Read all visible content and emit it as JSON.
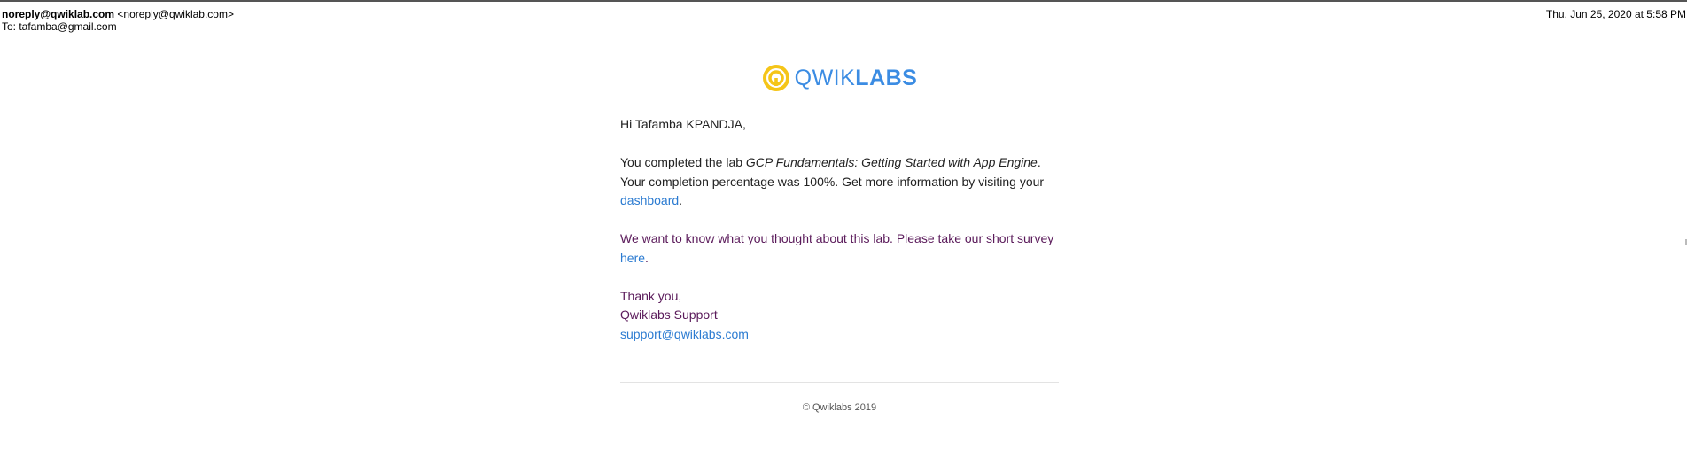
{
  "header": {
    "from_name": "noreply@qwiklab.com",
    "from_address": "<noreply@qwiklab.com>",
    "to_line": "To: tafamba@gmail.com",
    "date": "Thu, Jun 25, 2020 at 5:58 PM"
  },
  "logo": {
    "text_light": "QWIK",
    "text_bold": "LABS",
    "colors": {
      "ring": "#f5c518",
      "text": "#3b8ce3"
    }
  },
  "email": {
    "greeting": "Hi Tafamba KPANDJA,",
    "completed_prefix": "You completed the lab ",
    "lab_name": "GCP Fundamentals: Getting Started with App Engine",
    "completed_suffix": ".",
    "percentage_text": "Your completion percentage was 100%. Get more information by visiting your",
    "dashboard_link": "dashboard",
    "dashboard_suffix": ".",
    "survey_prefix": "We want to know what you thought about this lab. Please take our short survey ",
    "survey_link": "here",
    "survey_suffix": ".",
    "thanks": "Thank you,",
    "signature": "Qwiklabs Support",
    "support_email": "support@qwiklabs.com",
    "colors": {
      "link": "#2b7bd1",
      "purple_text": "#5a1a5a"
    }
  },
  "footer": {
    "copyright": "© Qwiklabs 2019"
  }
}
